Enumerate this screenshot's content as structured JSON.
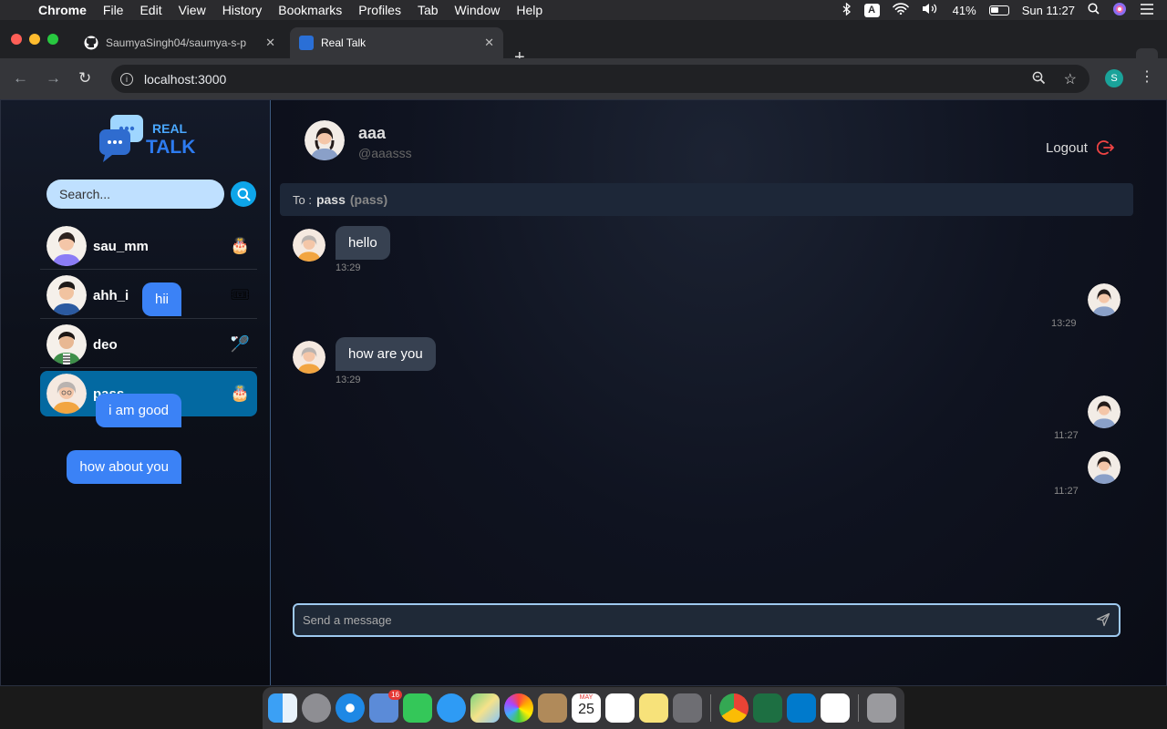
{
  "menubar": {
    "app": "Chrome",
    "items": [
      "File",
      "Edit",
      "View",
      "History",
      "Bookmarks",
      "Profiles",
      "Tab",
      "Window",
      "Help"
    ],
    "battery": "41%",
    "clock": "Sun 11:27",
    "input_source": "A"
  },
  "tabs": [
    {
      "title": "SaumyaSingh04/saumya-s-p",
      "active": false
    },
    {
      "title": "Real Talk",
      "active": true
    }
  ],
  "address": {
    "url": "localhost:3000",
    "profile_initial": "S"
  },
  "sidebar": {
    "logo_top": "REAL",
    "logo_bottom": "TALK",
    "search_placeholder": "Search...",
    "contacts": [
      {
        "name": "sau_mm",
        "emoji": "🎂",
        "active": false
      },
      {
        "name": "ahh_i",
        "emoji": "🎟",
        "active": false
      },
      {
        "name": "deo",
        "emoji": "🏸",
        "active": false
      },
      {
        "name": "pass",
        "emoji": "🎂",
        "active": true
      }
    ]
  },
  "chat": {
    "user_name": "aaa",
    "user_handle": "@aaasss",
    "logout_label": "Logout",
    "to_label": "To :",
    "to_name": "pass",
    "to_user": "(pass)",
    "messages": [
      {
        "text": "hello",
        "time": "13:29",
        "dir": "in"
      },
      {
        "text": "hii",
        "time": "13:29",
        "dir": "out"
      },
      {
        "text": "how are you",
        "time": "13:29",
        "dir": "in"
      },
      {
        "text": "i am good",
        "time": "11:27",
        "dir": "out"
      },
      {
        "text": "how about you",
        "time": "11:27",
        "dir": "out"
      }
    ],
    "composer_placeholder": "Send a message"
  },
  "dock": {
    "mail_badge": "16",
    "calendar_month": "MAY",
    "calendar_day": "25"
  },
  "colors": {
    "accent": "#0ea5e9",
    "active_contact": "#0369a1",
    "out_bubble": "#3b82f6",
    "in_bubble": "#374151",
    "logout_icon": "#ef4444"
  }
}
